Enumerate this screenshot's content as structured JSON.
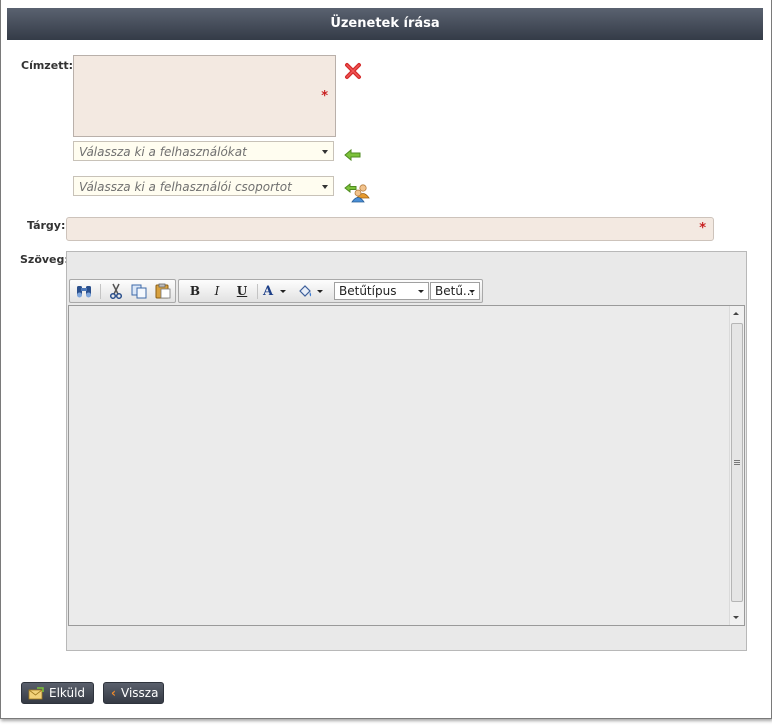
{
  "window": {
    "title": "Üzenetek írása"
  },
  "form": {
    "recipient_label": "Címzett:",
    "required_mark": "*",
    "users_combo": {
      "placeholder": "Válassza ki a felhasználókat"
    },
    "groups_combo": {
      "placeholder": "Válassza ki a felhasználói csoportot"
    },
    "subject_label": "Tárgy:",
    "text_label": "Szöveg:"
  },
  "editor": {
    "toolbar": {
      "bold": "B",
      "italic": "I",
      "underline": "U",
      "font_color": "A",
      "font_family": "Betűtípus",
      "font_size": "Betű..."
    }
  },
  "buttons": {
    "send": "Elküld",
    "back": "Vissza"
  },
  "colors": {
    "title_bar": "#434a56",
    "required_field": "#f3e9e1",
    "combo_bg": "#fffdf0",
    "required_mark": "#c82020"
  }
}
